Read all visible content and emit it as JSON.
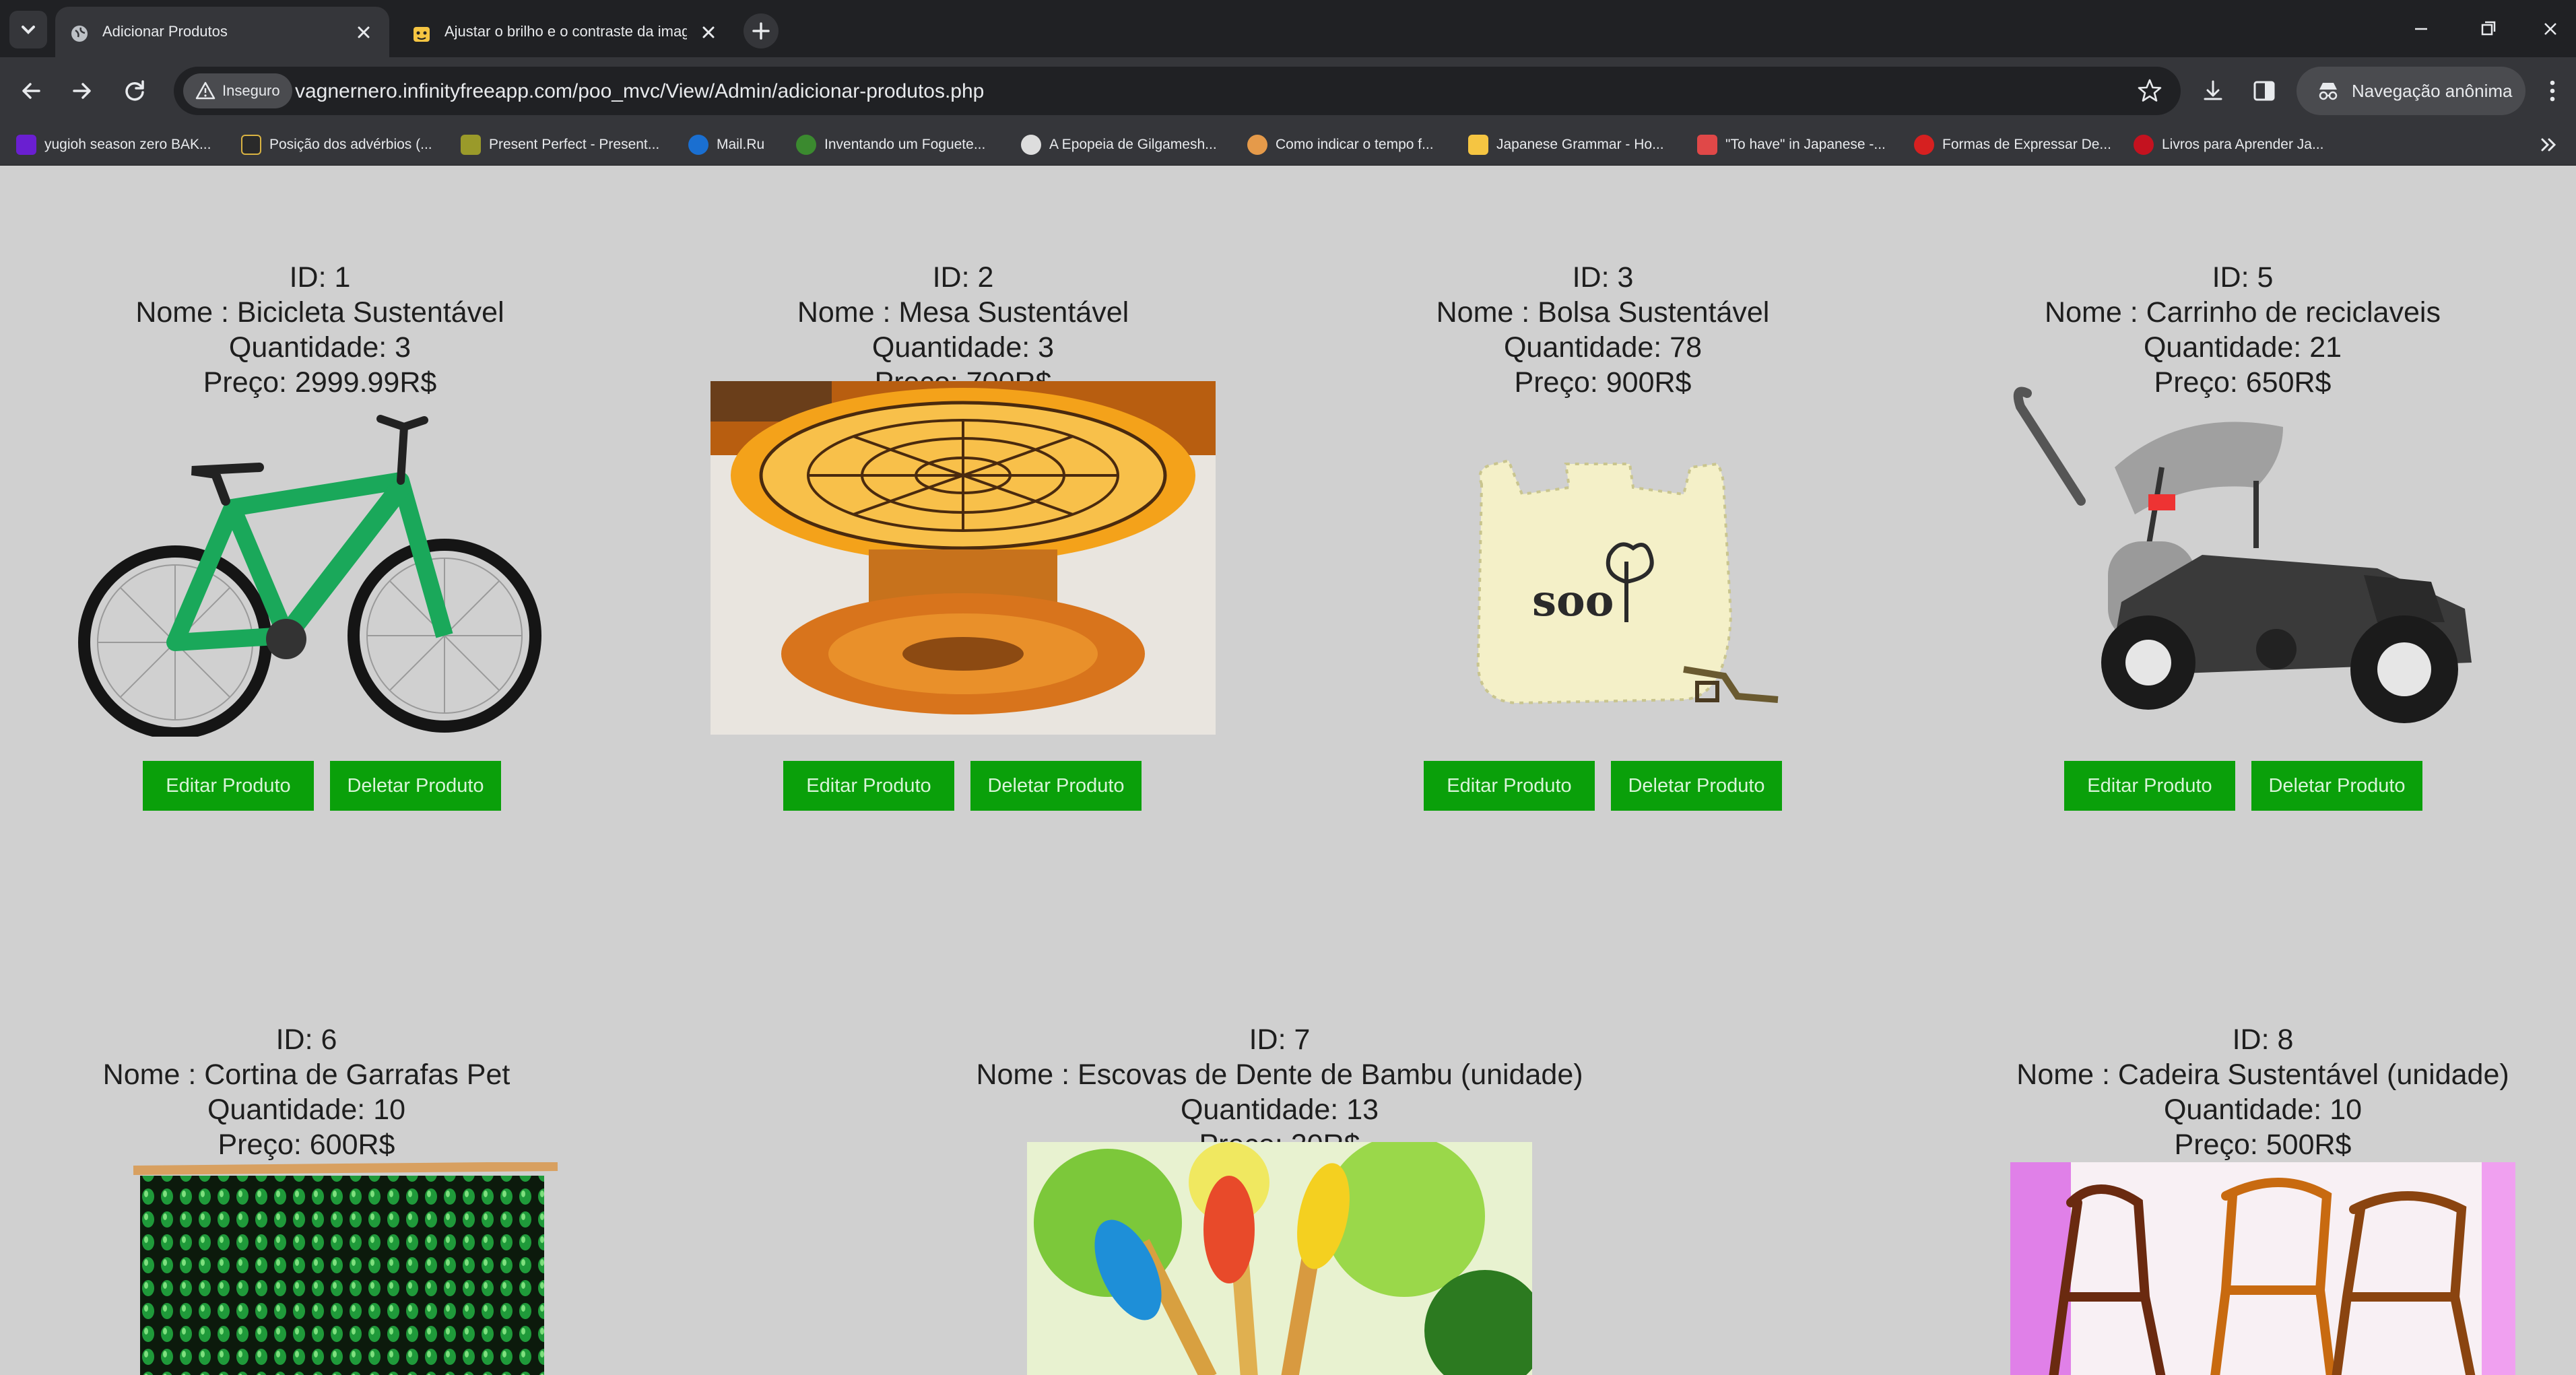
{
  "browser": {
    "tabs": [
      {
        "title": "Adicionar Produtos",
        "active": true
      },
      {
        "title": "Ajustar o brilho e o contraste da imag",
        "active": false
      }
    ],
    "security_label": "Inseguro",
    "url": "vagnernero.infinityfreeapp.com/poo_mvc/View/Admin/adicionar-produtos.php",
    "incognito_label": "Navegação anônima",
    "bookmarks": [
      {
        "label": "yugioh season zero BAK...",
        "color": "#6a1fd1"
      },
      {
        "label": "Posição dos advérbios (...",
        "color": "#2a2a2a"
      },
      {
        "label": "Present Perfect - Present...",
        "color": "#9a9a2a"
      },
      {
        "label": "Mail.Ru",
        "color": "#1a6fd1"
      },
      {
        "label": "Inventando um Foguete...",
        "color": "#3b8a2f"
      },
      {
        "label": "A Epopeia de Gilgamesh...",
        "color": "#dddddd"
      },
      {
        "label": "Como indicar o tempo f...",
        "color": "#e59a4a"
      },
      {
        "label": "Japanese Grammar - Ho...",
        "color": "#f5c542"
      },
      {
        "label": "\"To have\" in Japanese -...",
        "color": "#e04848"
      },
      {
        "label": "Formas de Expressar De...",
        "color": "#d62020"
      },
      {
        "label": "Livros para Aprender Ja...",
        "color": "#c4121f"
      }
    ]
  },
  "labels": {
    "edit_button": "Editar Produto",
    "delete_button": "Deletar Produto"
  },
  "products": [
    {
      "id_line": "ID: 1",
      "name_line": "Nome : Bicicleta Sustentável",
      "qty_line": "Quantidade: 3",
      "price_line": "Preço: 2999.99R$"
    },
    {
      "id_line": "ID: 2",
      "name_line": "Nome : Mesa Sustentável",
      "qty_line": "Quantidade: 3",
      "price_line": "Preço: 700R$"
    },
    {
      "id_line": "ID: 3",
      "name_line": "Nome : Bolsa Sustentável",
      "qty_line": "Quantidade: 78",
      "price_line": "Preço: 900R$",
      "image_text": "soo"
    },
    {
      "id_line": "ID: 5",
      "name_line": "Nome : Carrinho de reciclaveis",
      "qty_line": "Quantidade: 21",
      "price_line": "Preço: 650R$"
    },
    {
      "id_line": "ID: 6",
      "name_line": "Nome : Cortina de Garrafas Pet",
      "qty_line": "Quantidade: 10",
      "price_line": "Preço: 600R$"
    },
    {
      "id_line": "ID: 7",
      "name_line": "Nome : Escovas de Dente de Bambu (unidade)",
      "qty_line": "Quantidade: 13",
      "price_line": "Preço: 20R$"
    },
    {
      "id_line": "ID: 8",
      "name_line": "Nome : Cadeira Sustentável (unidade)",
      "qty_line": "Quantidade: 10",
      "price_line": "Preço: 500R$"
    }
  ],
  "colors": {
    "page_bg": "#d0d0d0",
    "button_bg": "#0aa00a",
    "button_text": "#d8f4d8",
    "chrome_dark": "#202124",
    "chrome_toolbar": "#35363a"
  }
}
